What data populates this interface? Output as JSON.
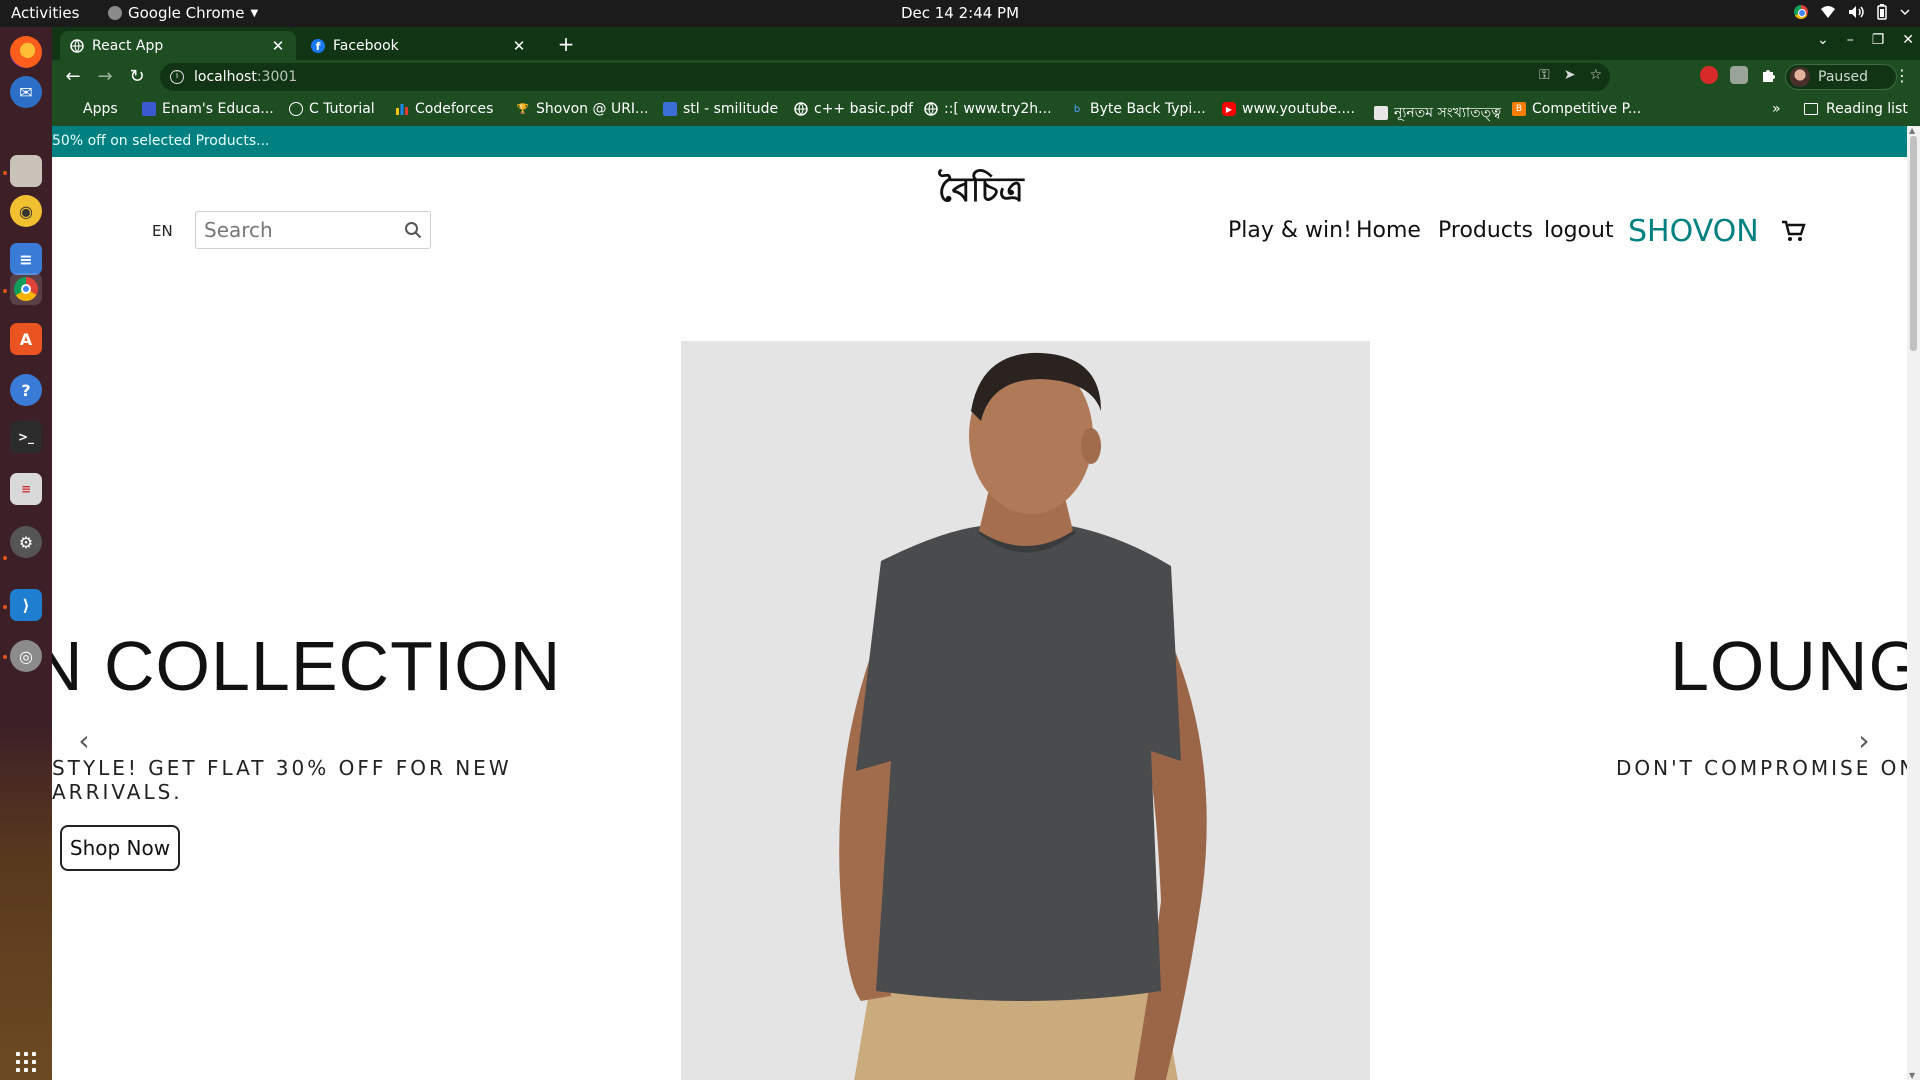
{
  "os": {
    "activities": "Activities",
    "app_name": "Google Chrome",
    "clock": "Dec 14  2:44 PM"
  },
  "browser": {
    "tabs": [
      {
        "label": "React App",
        "icon": "globe-icon",
        "active": true
      },
      {
        "label": "Facebook",
        "icon": "facebook-icon",
        "active": false
      }
    ],
    "url_host": "localhost",
    "url_port": ":3001",
    "profile_label": "Paused",
    "bookmarks": [
      {
        "label": "Apps",
        "icon": "apps-grid-icon"
      },
      {
        "label": "Enam's Educa...",
        "icon": "bookmark-icon"
      },
      {
        "label": "C Tutorial",
        "icon": "bookmark-icon"
      },
      {
        "label": "Codeforces",
        "icon": "codeforces-icon"
      },
      {
        "label": "Shovon @ URI...",
        "icon": "trophy-icon"
      },
      {
        "label": "stl - smilitude",
        "icon": "bookmark-icon"
      },
      {
        "label": "c++ basic.pdf",
        "icon": "globe-icon"
      },
      {
        "label": "::[ www.try2h...",
        "icon": "globe-icon"
      },
      {
        "label": "Byte Back Typi...",
        "icon": "bookmark-icon"
      },
      {
        "label": "www.youtube....",
        "icon": "youtube-icon"
      },
      {
        "label": "ন্যূনতম সংখ্যাতত্ত্ব",
        "icon": "bookmark-icon"
      },
      {
        "label": "Competitive P...",
        "icon": "blogger-icon"
      }
    ],
    "bookmarks_more": "»",
    "reading_list": "Reading list"
  },
  "page": {
    "promo": "50% off on selected Products...",
    "brand": "বৈচিত্র",
    "lang": "EN",
    "search_placeholder": "Search",
    "nav": {
      "play": "Play & win!",
      "home": "Home",
      "products": "Products",
      "logout": "logout",
      "user": "SHOVON"
    },
    "carousel": {
      "left_heading": "N COLLECTION",
      "left_sub": "STYLE! GET FLAT 30% OFF FOR NEW ARRIVALS.",
      "shop_now": "Shop Now",
      "right_heading": "LOUNGE",
      "right_sub": "DON'T COMPROMISE ON"
    }
  },
  "colors": {
    "tab_strip": "#113514",
    "toolbar": "#1e4d22",
    "promo_bar": "#008080",
    "accent_user": "#008080"
  }
}
